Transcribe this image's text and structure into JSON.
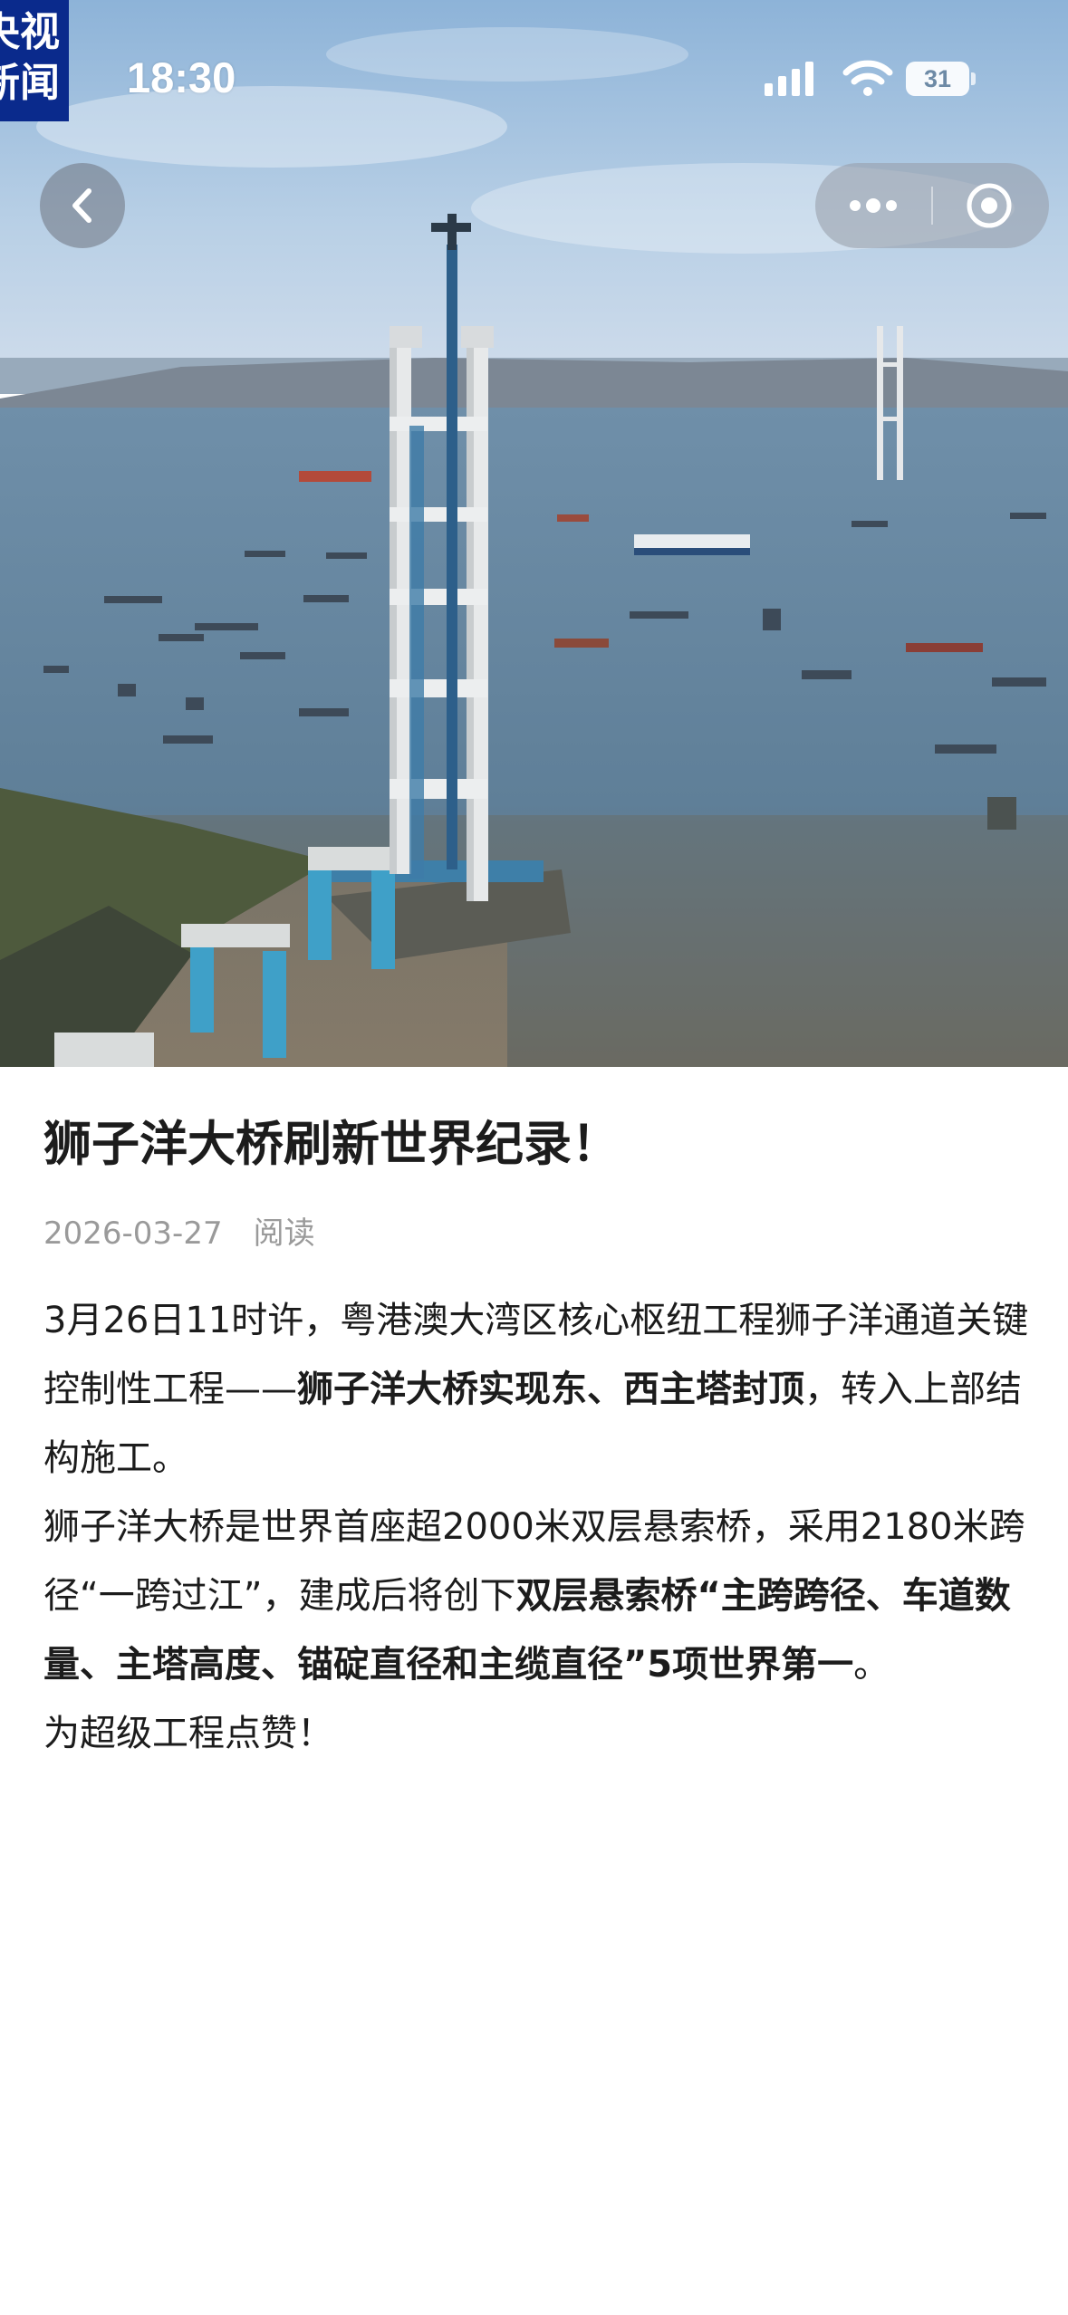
{
  "status_bar": {
    "logo_line1": "央视",
    "logo_line2": "新闻",
    "time": "18:30",
    "battery": "31",
    "icons": [
      "signal-icon",
      "wifi-icon",
      "battery-icon"
    ]
  },
  "nav": {
    "back_icon": "chevron-left-icon",
    "more_icon": "more-dots-icon",
    "close_icon": "target-circle-icon"
  },
  "hero_image": {
    "subject": "bridge tower photo"
  },
  "article": {
    "title": "狮子洋大桥刷新世界纪录！",
    "date": "2026-03-27",
    "read_label": "阅读",
    "p1_a": "3月26日11时许，粤港澳大湾区核心枢纽工程狮子洋通道关键控制性工程——",
    "p1_bold": "狮子洋大桥实现东、西主塔封顶",
    "p1_b": "，转入上部结构施工。",
    "p2_a": "狮子洋大桥是世界首座超2000米双层悬索桥，采用2180米跨径“一跨过江”，建成后将创下",
    "p2_bold": "双层悬索桥“主跨跨径、车道数量、主塔高度、锚碇直径和主缆直径”5项世界第一",
    "p2_b": "。",
    "p3": "为超级工程点赞！"
  },
  "colors": {
    "logo_bg": "#0a2a8c",
    "title": "#1c1c1c",
    "meta": "#9a9a9a"
  }
}
